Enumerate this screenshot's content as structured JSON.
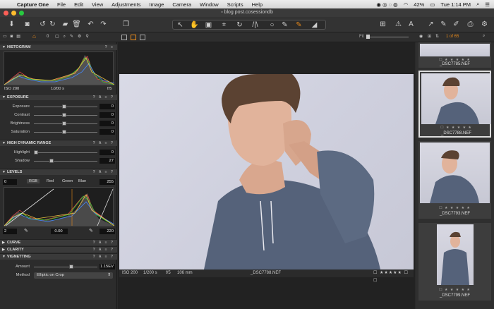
{
  "menubar": {
    "app_name": "Capture One",
    "items": [
      "File",
      "Edit",
      "View",
      "Adjustments",
      "Image",
      "Camera",
      "Window",
      "Scripts",
      "Help"
    ],
    "battery": "42%",
    "clock": "Tue 1:14 PM"
  },
  "window": {
    "title": "blog post.cosessiondb"
  },
  "toolbar": {
    "counter": "1 of 65",
    "fit_label": "Fit"
  },
  "panel": {
    "count_badge": "0",
    "histogram": {
      "title": "HISTOGRAM",
      "iso": "ISO 200",
      "shutter": "1/200 s",
      "aperture": "f/5"
    },
    "exposure": {
      "title": "EXPOSURE",
      "rows": [
        {
          "label": "Exposure",
          "value": "0"
        },
        {
          "label": "Contrast",
          "value": "0"
        },
        {
          "label": "Brightness",
          "value": "0"
        },
        {
          "label": "Saturation",
          "value": "0"
        }
      ]
    },
    "hdr": {
      "title": "HIGH DYNAMIC RANGE",
      "rows": [
        {
          "label": "Highlight",
          "value": "0"
        },
        {
          "label": "Shadow",
          "value": "27"
        }
      ]
    },
    "levels": {
      "title": "LEVELS",
      "low": "0",
      "high": "255",
      "channels": [
        "RGB",
        "Red",
        "Green",
        "Blue"
      ],
      "out_low": "2",
      "mid": "0.00",
      "out_high": "220"
    },
    "curve": {
      "title": "CURVE"
    },
    "clarity": {
      "title": "CLARITY"
    },
    "vignetting": {
      "title": "VIGNETTING",
      "amount_label": "Amount",
      "amount_value": "1.15EV",
      "method_label": "Method",
      "method_value": "Elliptic on Crop"
    }
  },
  "viewer": {
    "iso": "ISO 200",
    "shutter": "1/200 s",
    "aperture": "f/5",
    "focal": "106 mm",
    "filename": "_DSC7788.NEF"
  },
  "browser": {
    "thumbs": [
      {
        "name": "_DSC7785.NEF"
      },
      {
        "name": "_DSC7788.NEF"
      },
      {
        "name": "_DSC7793.NEF"
      },
      {
        "name": "_DSC7799.NEF"
      }
    ]
  },
  "colors": {
    "accent": "#e88a1a",
    "bg": "#2c2c2c",
    "photo_bg": "#cfd0de"
  },
  "icons": [
    "import-icon",
    "camera-icon",
    "undo-icon",
    "redo-icon",
    "trash-icon",
    "cursor-icon",
    "crop-icon",
    "brush-icon",
    "eraser-icon",
    "grid-icon",
    "warning-icon",
    "print-icon",
    "settings-icon"
  ]
}
